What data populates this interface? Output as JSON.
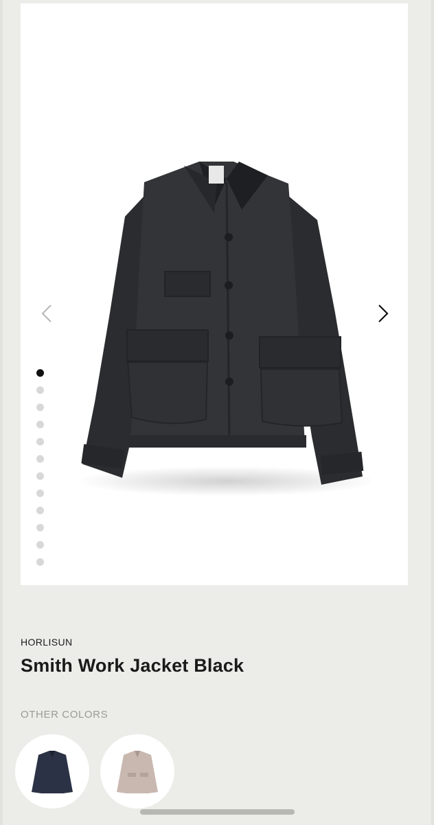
{
  "gallery": {
    "image_icon": "work-jacket-black-photo",
    "prev_icon": "chevron-left-icon",
    "next_icon": "chevron-right-icon",
    "slide_count": 12,
    "active_slide": 1
  },
  "product": {
    "brand": "HORLISUN",
    "title": "Smith Work Jacket Black"
  },
  "other_colors": {
    "label": "OTHER COLORS",
    "swatches": [
      {
        "icon": "navy-jacket-thumbnail",
        "color": "#2b3245"
      },
      {
        "icon": "beige-jacket-thumbnail",
        "color": "#c9b8b0"
      }
    ]
  },
  "colors": {
    "background": "#ecece8",
    "text": "#1a1a1a",
    "muted": "#9a9a96",
    "jacket": "#2f3033"
  }
}
